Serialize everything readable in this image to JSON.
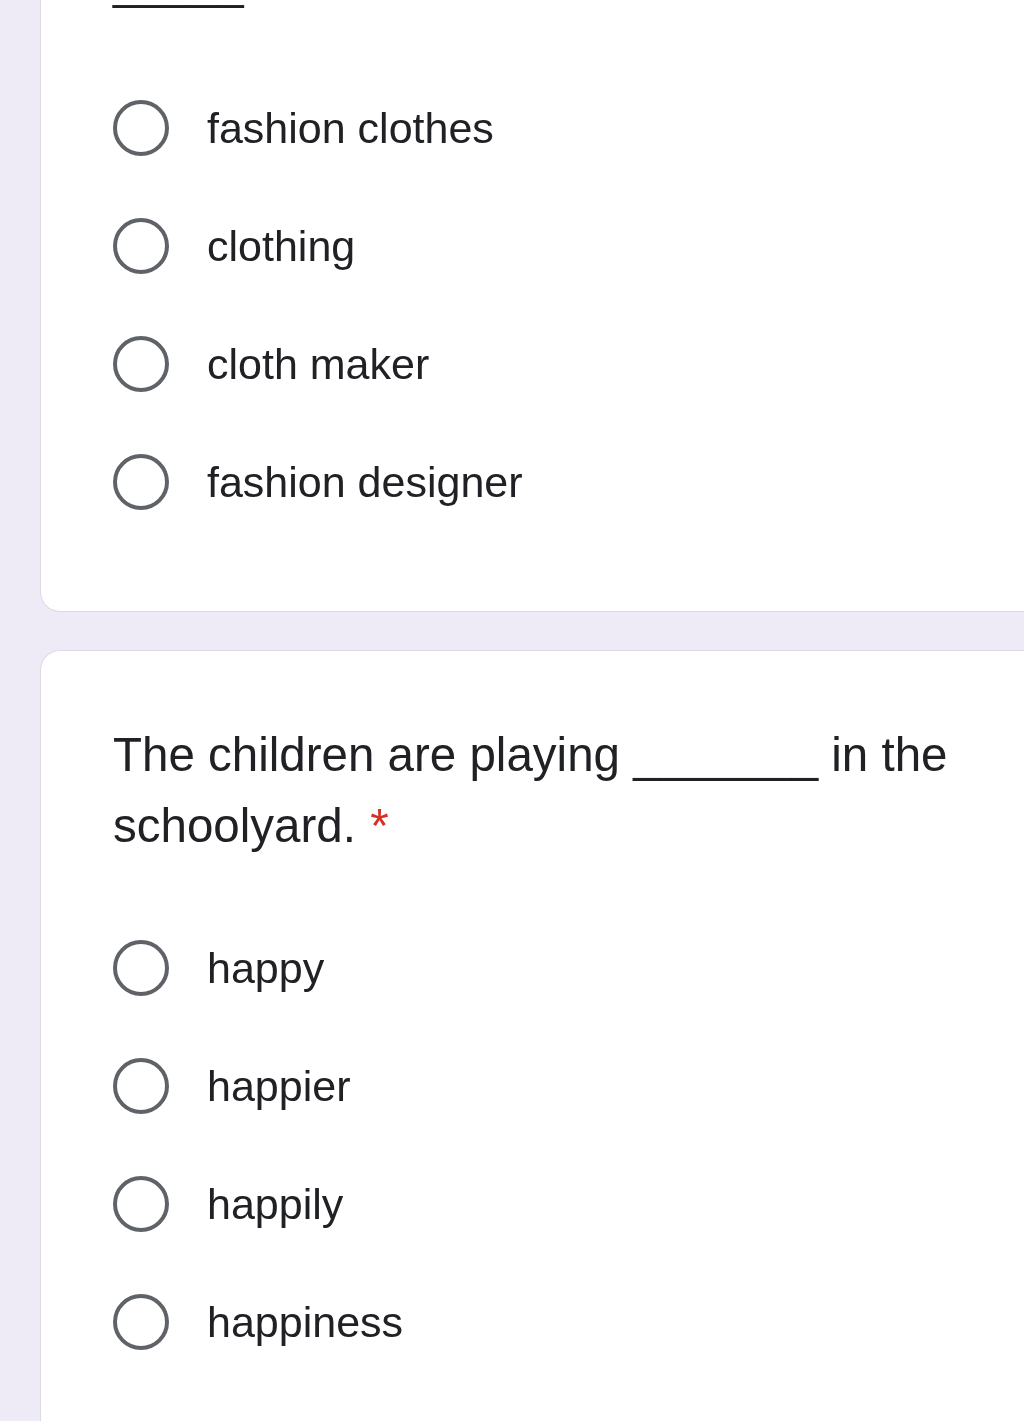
{
  "questions": [
    {
      "kind": "clipped",
      "prompt": "_____",
      "options": [
        {
          "label": "fashion clothes",
          "selected": false
        },
        {
          "label": "clothing",
          "selected": false
        },
        {
          "label": "cloth maker",
          "selected": false
        },
        {
          "label": "fashion designer",
          "selected": false
        }
      ]
    },
    {
      "kind": "full",
      "prompt": "The children are playing _______ in the schoolyard.",
      "required_mark": "*",
      "options": [
        {
          "label": "happy",
          "selected": false
        },
        {
          "label": "happier",
          "selected": false
        },
        {
          "label": "happily",
          "selected": false
        },
        {
          "label": "happiness",
          "selected": false
        }
      ]
    }
  ]
}
